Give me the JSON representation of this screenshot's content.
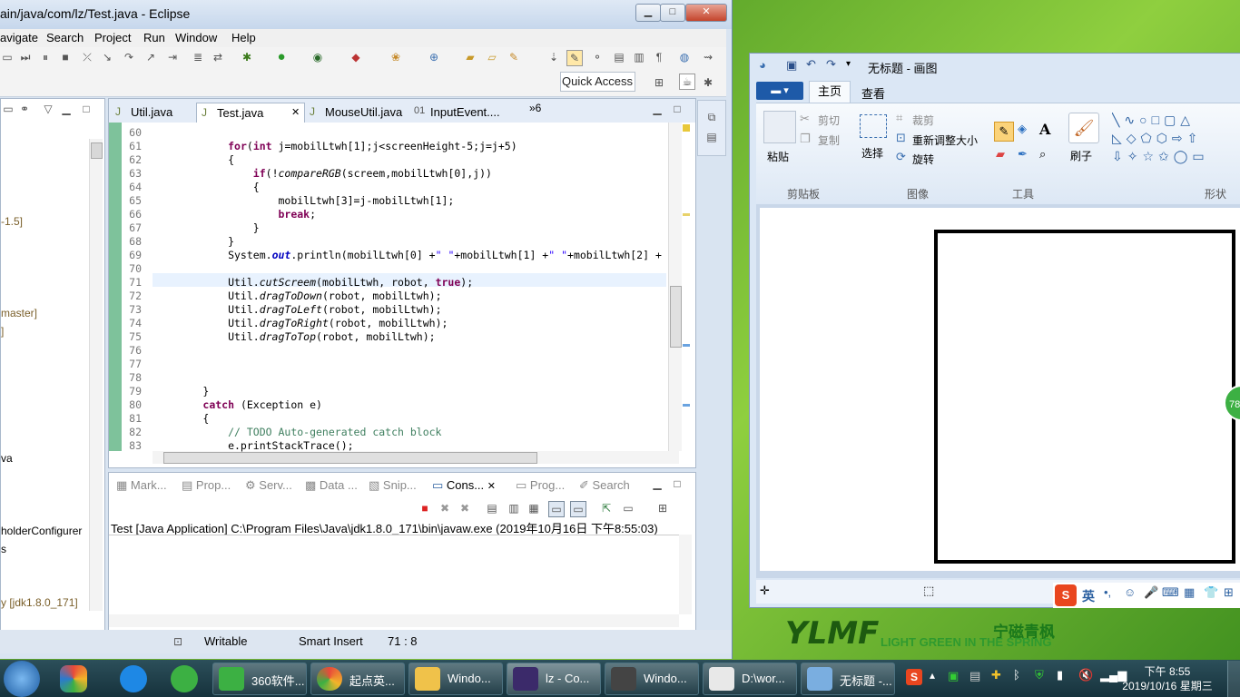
{
  "eclipse": {
    "title": "ain/java/com/lz/Test.java - Eclipse",
    "menu": [
      "avigate",
      "Search",
      "Project",
      "Run",
      "Window",
      "Help"
    ],
    "quick_access": "Quick Access",
    "tabs": [
      "Util.java",
      "Test.java",
      "MouseUtil.java",
      "InputEvent...."
    ],
    "tab_overflow": "»6",
    "left_panel": [
      "-1.5]",
      "master]",
      "]",
      "va",
      "holderConfigurer",
      "s",
      "y [jdk1.8.0_171]"
    ],
    "lines": [
      {
        "n": "60",
        "code": ""
      },
      {
        "n": "61",
        "code": "            for(int j=mobilLtwh[1];j<screenHeight-5;j=j+5)"
      },
      {
        "n": "62",
        "code": "            {"
      },
      {
        "n": "63",
        "code": "                if(!compareRGB(screem,mobilLtwh[0],j))"
      },
      {
        "n": "64",
        "code": "                {"
      },
      {
        "n": "65",
        "code": "                    mobilLtwh[3]=j-mobilLtwh[1];"
      },
      {
        "n": "66",
        "code": "                    break;"
      },
      {
        "n": "67",
        "code": "                }"
      },
      {
        "n": "68",
        "code": "            }"
      },
      {
        "n": "69",
        "code": "            System.out.println(mobilLtwh[0] +\" \"+mobilLtwh[1] +\" \"+mobilLtwh[2] +"
      },
      {
        "n": "70",
        "code": ""
      },
      {
        "n": "71",
        "code": "            Util.cutScreem(mobilLtwh, robot, true);"
      },
      {
        "n": "72",
        "code": "            Util.dragToDown(robot, mobilLtwh);"
      },
      {
        "n": "73",
        "code": "            Util.dragToLeft(robot, mobilLtwh);"
      },
      {
        "n": "74",
        "code": "            Util.dragToRight(robot, mobilLtwh);"
      },
      {
        "n": "75",
        "code": "            Util.dragToTop(robot, mobilLtwh);"
      },
      {
        "n": "76",
        "code": ""
      },
      {
        "n": "77",
        "code": ""
      },
      {
        "n": "78",
        "code": ""
      },
      {
        "n": "79",
        "code": "        }"
      },
      {
        "n": "80",
        "code": "        catch (Exception e)"
      },
      {
        "n": "81",
        "code": "        {"
      },
      {
        "n": "82",
        "code": "            // TODO Auto-generated catch block"
      },
      {
        "n": "83",
        "code": "            e.printStackTrace();"
      }
    ],
    "console_tabs": [
      "Mark...",
      "Prop...",
      "Serv...",
      "Data ...",
      "Snip...",
      "Cons...",
      "Prog...",
      "Search"
    ],
    "console_path": "Test [Java Application] C:\\Program Files\\Java\\jdk1.8.0_171\\bin\\javaw.exe (2019年10月16日 下午8:55:03)",
    "status": {
      "mode": "Writable",
      "insert": "Smart Insert",
      "pos": "71 : 8"
    }
  },
  "paint": {
    "title": "无标题 - 画图",
    "tabs": [
      "主页",
      "查看"
    ],
    "clipboard": {
      "paste": "粘贴",
      "cut": "剪切",
      "copy": "复制",
      "group": "剪贴板"
    },
    "image": {
      "select": "选择",
      "crop": "裁剪",
      "resize": "重新调整大小",
      "rotate": "旋转",
      "group": "图像"
    },
    "tools_group": "工具",
    "brush": "刷子",
    "shapes_group": "形状"
  },
  "ime": {
    "lang": "英"
  },
  "brand": {
    "text": "宁磁青枫",
    "sub": "LIGHT GREEN IN THE SPRING"
  },
  "taskbar": {
    "tasks": [
      "360软件...",
      "起点英...",
      "Windo...",
      "lz - Co...",
      "Windo...",
      "D:\\wor...",
      "无标题 -..."
    ],
    "time": "下午 8:55",
    "date": "2019/10/16 星期三"
  }
}
